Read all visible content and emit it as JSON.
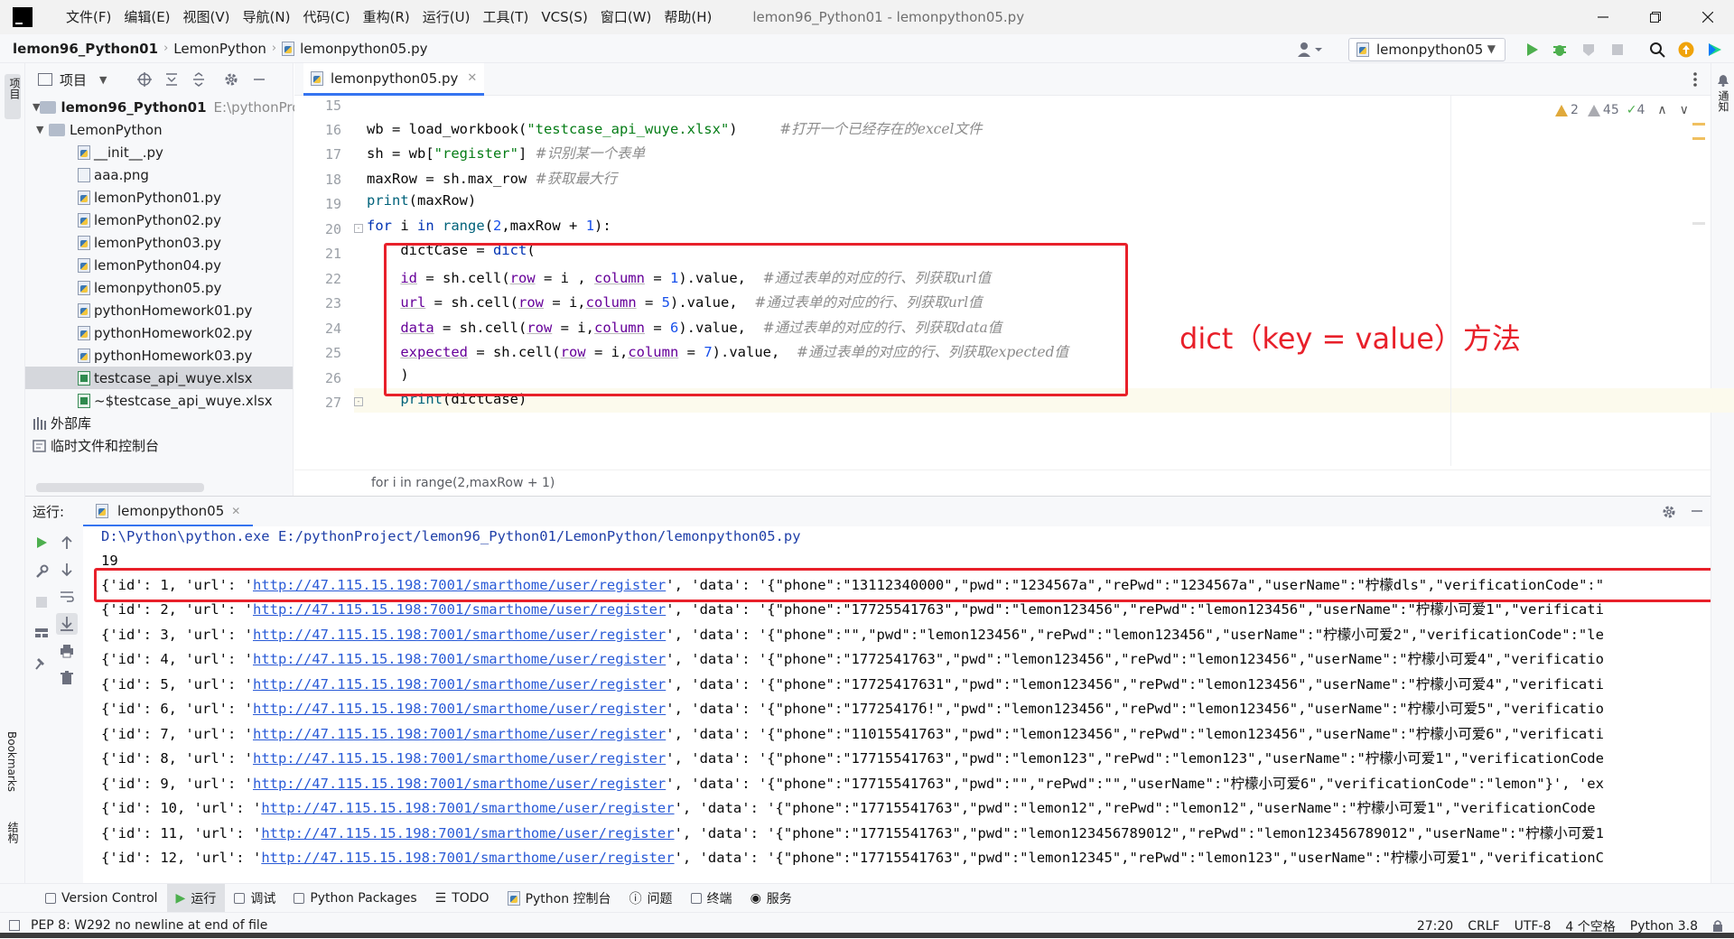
{
  "window": {
    "title": "lemon96_Python01 - lemonpython05.py",
    "menu": [
      "文件(F)",
      "编辑(E)",
      "视图(V)",
      "导航(N)",
      "代码(C)",
      "重构(R)",
      "运行(U)",
      "工具(T)",
      "VCS(S)",
      "窗口(W)",
      "帮助(H)"
    ]
  },
  "navbar": {
    "crumbs": [
      "lemon96_Python01",
      "LemonPython",
      "lemonpython05.py"
    ],
    "run_config": "lemonpython05"
  },
  "sidestrip": {
    "left_top": "项目",
    "left_bottom1": "Bookmarks",
    "left_bottom2": "结构",
    "right_top": "通知"
  },
  "project": {
    "header": "项目",
    "root_name": "lemon96_Python01",
    "root_path": "E:\\pythonProje",
    "folder": "LemonPython",
    "files": [
      {
        "name": "__init__.py",
        "type": "py"
      },
      {
        "name": "aaa.png",
        "type": "png"
      },
      {
        "name": "lemonPython01.py",
        "type": "py"
      },
      {
        "name": "lemonPython02.py",
        "type": "py"
      },
      {
        "name": "lemonPython03.py",
        "type": "py"
      },
      {
        "name": "lemonPython04.py",
        "type": "py"
      },
      {
        "name": "lemonpython05.py",
        "type": "py"
      },
      {
        "name": "pythonHomework01.py",
        "type": "py"
      },
      {
        "name": "pythonHomework02.py",
        "type": "py"
      },
      {
        "name": "pythonHomework03.py",
        "type": "py"
      },
      {
        "name": "testcase_api_wuye.xlsx",
        "type": "xlsx",
        "selected": true
      },
      {
        "name": "~$testcase_api_wuye.xlsx",
        "type": "xlsx"
      }
    ],
    "external_libs": "外部库",
    "scratches": "临时文件和控制台"
  },
  "editor": {
    "tab": "lemonpython05.py",
    "inspections": {
      "warnings": "2",
      "weak_warnings": "45",
      "typos": "4"
    },
    "line_numbers": [
      "15",
      "16",
      "17",
      "18",
      "19",
      "20",
      "21",
      "22",
      "23",
      "24",
      "25",
      "26",
      "27"
    ],
    "breadcrumb": "for i in range(2,maxRow + 1)",
    "annotation": "dict（key = value）方法"
  },
  "code": {
    "l16a": "wb = load_workbook(",
    "l16s": "\"testcase_api_wuye.xlsx\"",
    "l16b": ")     ",
    "l16c": "#打开一个已经存在的excel文件",
    "l17a": "sh = wb[",
    "l17s": "\"register\"",
    "l17b": "] ",
    "l17c": "#识别某一个表单",
    "l18a": "maxRow = sh.max_row ",
    "l18c": "#获取最大行",
    "l19f": "print",
    "l19a": "(maxRow)",
    "l20k1": "for",
    "l20a": " i ",
    "l20k2": "in",
    "l20b": " ",
    "l20f": "range",
    "l20c": "(",
    "l20n1": "2",
    "l20d": ",maxRow + ",
    "l20n2": "1",
    "l20e": "):",
    "l21a": "    dictCase = ",
    "l21f": "dict",
    "l21b": "(",
    "l22p": "id",
    "l22a": " = sh.cell(",
    "l22p2": "row",
    "l22b": " = i , ",
    "l22p3": "column",
    "l22c": " = ",
    "l22n": "1",
    "l22d": ").value,  ",
    "l22cm": "#通过表单的对应的行、列获取url值",
    "l23p": "url",
    "l23a": " = sh.cell(",
    "l23p2": "row",
    "l23b": " = i,",
    "l23p3": "column",
    "l23c": " = ",
    "l23n": "5",
    "l23d": ").value,  ",
    "l23cm": "#通过表单的对应的行、列获取url值",
    "l24p": "data",
    "l24a": " = sh.cell(",
    "l24p2": "row",
    "l24b": " = i,",
    "l24p3": "column",
    "l24c": " = ",
    "l24n": "6",
    "l24d": ").value,  ",
    "l24cm": "#通过表单的对应的行、列获取data值",
    "l25p": "expected",
    "l25a": " = sh.cell(",
    "l25p2": "row",
    "l25b": " = i,",
    "l25p3": "column",
    "l25c": " = ",
    "l25n": "7",
    "l25d": ").value,  ",
    "l25cm": "#通过表单的对应的行、列获取expected值",
    "l26": "    )",
    "l27f": "print",
    "l27a": "(dictCase)"
  },
  "run": {
    "label": "运行:",
    "tab": "lemonpython05",
    "cmd": "D:\\Python\\python.exe E:/pythonProject/lemon96_Python01/LemonPython/lemonpython05.py",
    "maxrow": "19",
    "url": "http://47.115.15.198:7001/smarthome/user/register",
    "rows": [
      {
        "pre": "{'id': 1, 'url': '",
        "post": "', 'data': '{\"phone\":\"13112340000\",\"pwd\":\"1234567a\",\"rePwd\":\"1234567a\",\"userName\":\"柠檬dls\",\"verificationCode\":\""
      },
      {
        "pre": "{'id': 2, 'url': '",
        "post": "', 'data': '{\"phone\":\"17725541763\",\"pwd\":\"lemon123456\",\"rePwd\":\"lemon123456\",\"userName\":\"柠檬小可爱1\",\"verificati"
      },
      {
        "pre": "{'id': 3, 'url': '",
        "post": "', 'data': '{\"phone\":\"\",\"pwd\":\"lemon123456\",\"rePwd\":\"lemon123456\",\"userName\":\"柠檬小可爱2\",\"verificationCode\":\"le"
      },
      {
        "pre": "{'id': 4, 'url': '",
        "post": "', 'data': '{\"phone\":\"1772541763\",\"pwd\":\"lemon123456\",\"rePwd\":\"lemon123456\",\"userName\":\"柠檬小可爱4\",\"verificatio"
      },
      {
        "pre": "{'id': 5, 'url': '",
        "post": "', 'data': '{\"phone\":\"17725417631\",\"pwd\":\"lemon123456\",\"rePwd\":\"lemon123456\",\"userName\":\"柠檬小可爱4\",\"verificati"
      },
      {
        "pre": "{'id': 6, 'url': '",
        "post": "', 'data': '{\"phone\":\"17725417б!\",\"pwd\":\"lemon123456\",\"rePwd\":\"lemon123456\",\"userName\":\"柠檬小可爱5\",\"verificatio"
      },
      {
        "pre": "{'id': 7, 'url': '",
        "post": "', 'data': '{\"phone\":\"11015541763\",\"pwd\":\"lemon123456\",\"rePwd\":\"lemon123456\",\"userName\":\"柠檬小可爱6\",\"verificati"
      },
      {
        "pre": "{'id': 8, 'url': '",
        "post": "', 'data': '{\"phone\":\"17715541763\",\"pwd\":\"lemon123\",\"rePwd\":\"lemon123\",\"userName\":\"柠檬小可爱1\",\"verificationCode"
      },
      {
        "pre": "{'id': 9, 'url': '",
        "post": "', 'data': '{\"phone\":\"17715541763\",\"pwd\":\"\",\"rePwd\":\"\",\"userName\":\"柠檬小可爱6\",\"verificationCode\":\"lemon\"}', 'ex"
      },
      {
        "pre": "{'id': 10, 'url': '",
        "post": "', 'data': '{\"phone\":\"17715541763\",\"pwd\":\"lemon12\",\"rePwd\":\"lemon12\",\"userName\":\"柠檬小可爱1\",\"verificationCode"
      },
      {
        "pre": "{'id': 11, 'url': '",
        "post": "', 'data': '{\"phone\":\"17715541763\",\"pwd\":\"lemon123456789012\",\"rePwd\":\"lemon123456789012\",\"userName\":\"柠檬小可爱1"
      },
      {
        "pre": "{'id': 12, 'url': '",
        "post": "', 'data': '{\"phone\":\"17715541763\",\"pwd\":\"lemon12345\",\"rePwd\":\"lemon123\",\"userName\":\"柠檬小可爱1\",\"verificationC"
      }
    ]
  },
  "toolwindows": [
    "Version Control",
    "运行",
    "调试",
    "Python Packages",
    "TODO",
    "Python 控制台",
    "问题",
    "终端",
    "服务"
  ],
  "status": {
    "message": "PEP 8: W292 no newline at end of file",
    "position": "27:20",
    "line_sep": "CRLF",
    "encoding": "UTF-8",
    "indent": "4 个空格",
    "interpreter": "Python 3.8"
  },
  "colors": {
    "accent": "#3574f0",
    "highlight_red": "#e8202a",
    "run_green": "#4daf4e"
  }
}
